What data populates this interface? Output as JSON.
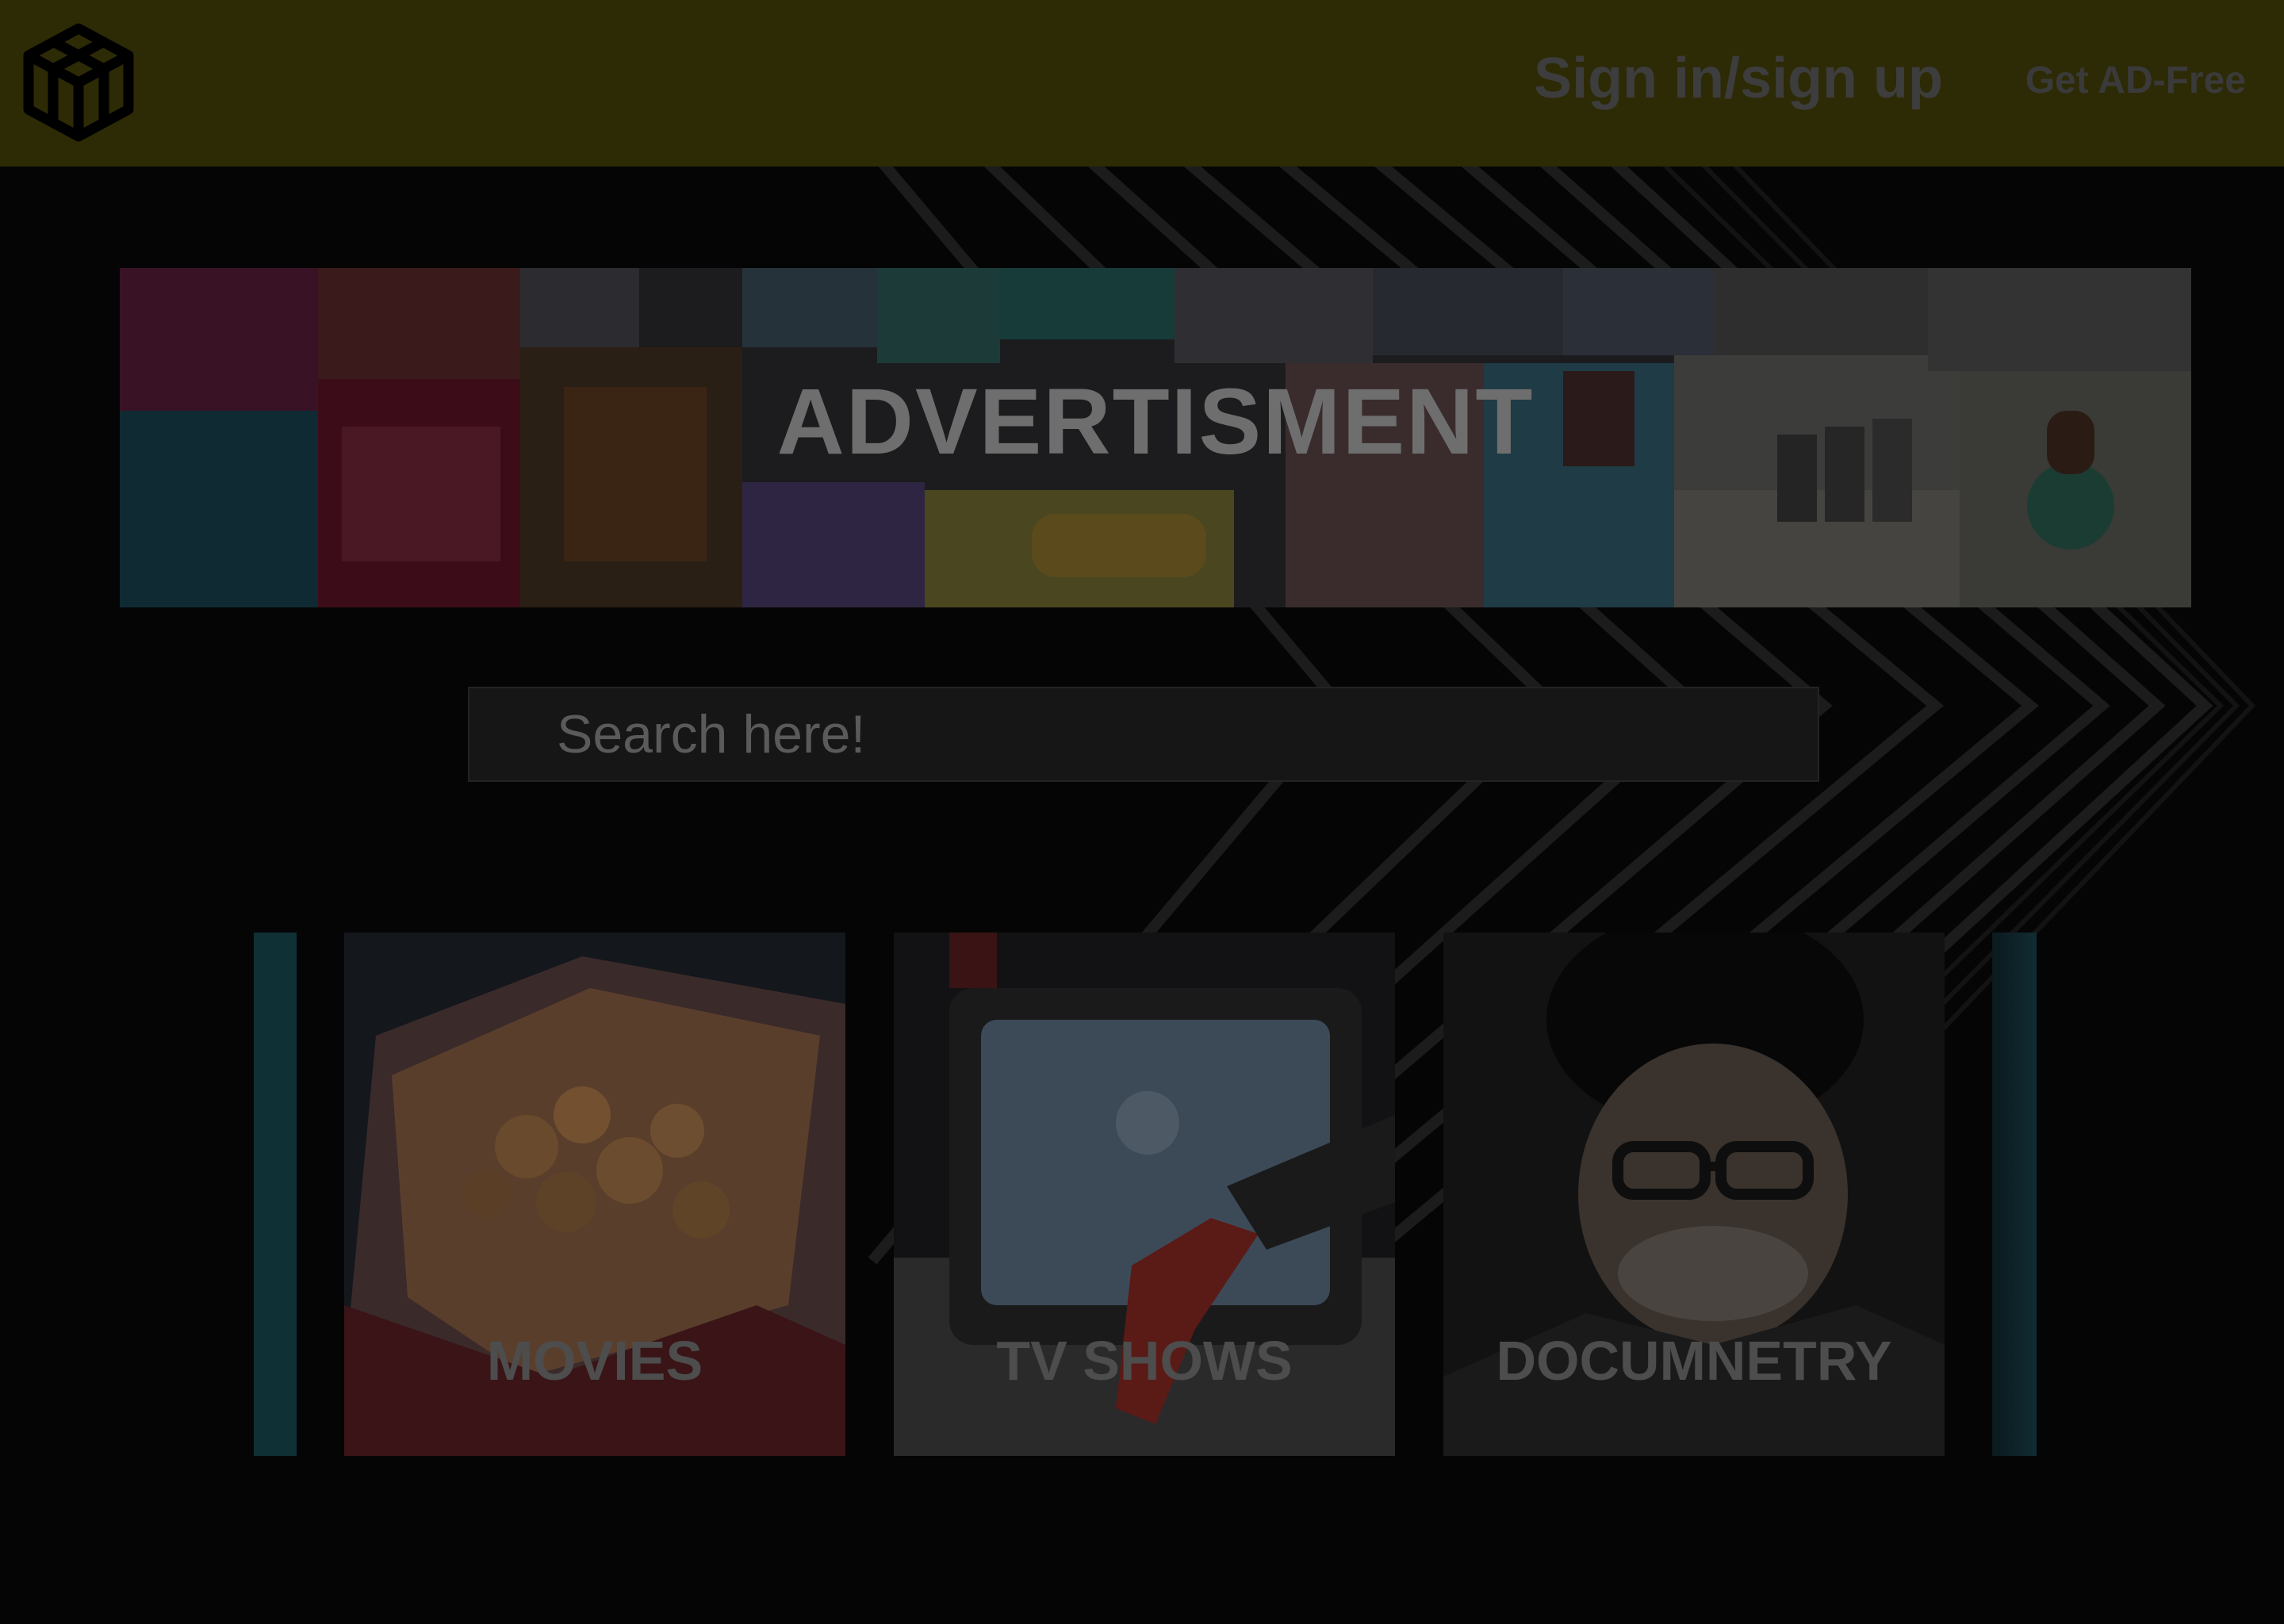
{
  "header": {
    "logo_icon": "codepen-cube-icon",
    "signin_label": "Sign in/sign up",
    "adfree_label": "Get AD-Free"
  },
  "ad": {
    "label": "ADVERTISMENT"
  },
  "search": {
    "placeholder": "Search here!"
  },
  "categories": [
    {
      "label": "MOVIES",
      "image": "popcorn-image"
    },
    {
      "label": "TV SHOWS",
      "image": "television-static-image"
    },
    {
      "label": "DOCUMNETRY",
      "image": "elderly-man-portrait-image"
    }
  ],
  "colors": {
    "topbar": "#2d2a06",
    "background": "#050505",
    "label_text": "#4d4d4d"
  }
}
